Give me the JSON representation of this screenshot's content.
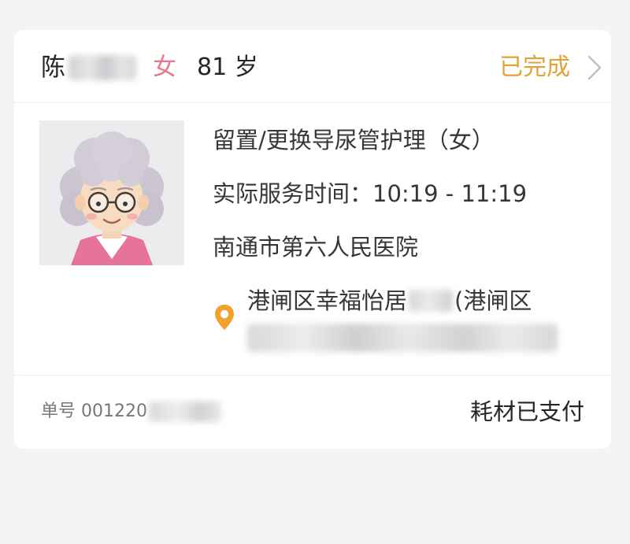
{
  "patient": {
    "surname": "陈",
    "gender": "女",
    "age": "81 岁"
  },
  "order_status": "已完成",
  "service": {
    "name": "留置/更换导尿管护理（女）",
    "time": "实际服务时间：10:19 - 11:19",
    "hospital": "南通市第六人民医院"
  },
  "address": {
    "line1_prefix": "港闸区幸福怡居",
    "line1_suffix": "(港闸区"
  },
  "footer": {
    "order_number_prefix": "单号 001220",
    "payment_status": "耗材已支付"
  },
  "colors": {
    "status": "#e0a33a",
    "gender": "#e8778d",
    "pin": "#f0a22e",
    "background": "#f4f4f6"
  },
  "icons": {
    "chevron": "chevron-right-icon",
    "location": "location-pin-icon",
    "avatar": "elderly-woman-avatar"
  }
}
